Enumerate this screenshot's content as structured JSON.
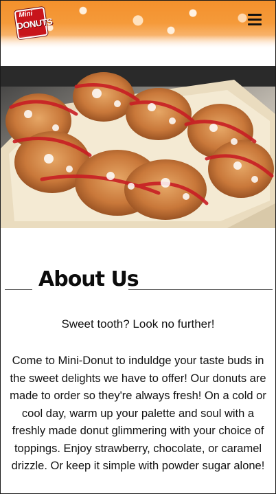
{
  "header": {
    "logo": {
      "line1": "Mini",
      "line2": "DONUTS"
    },
    "menu_icon": "hamburger-menu-icon"
  },
  "hero": {
    "image": "powdered-sugar-mini-donuts-with-strawberry-drizzle"
  },
  "about": {
    "heading": "About Us",
    "tagline": "Sweet tooth? Look no further!",
    "body": "Come to Mini-Donut to induldge your taste buds in the sweet delights we have to offer! Our donuts are made to order so they're always fresh! On a cold or cool day, warm up your palette and soul with a freshly made donut glimmering with your choice of toppings. Enjoy strawberry, chocolate, or caramel drizzle. Or keep it simple with powder sugar alone!"
  },
  "colors": {
    "header_orange": "#f3902c",
    "logo_red": "#c8151b",
    "text": "#111111"
  }
}
